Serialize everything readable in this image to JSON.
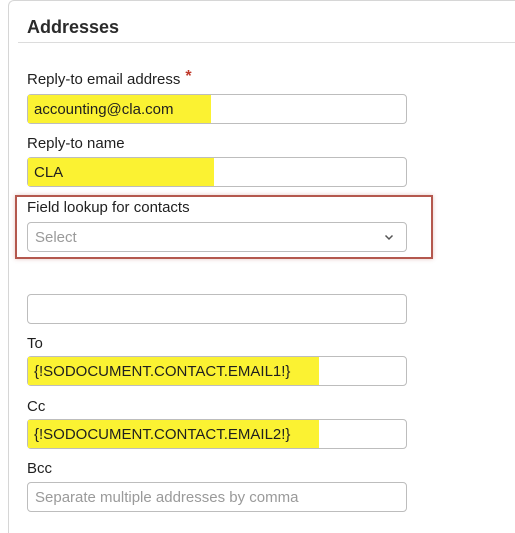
{
  "section": {
    "title": "Addresses"
  },
  "reply_to_email": {
    "label": "Reply-to email address",
    "required_mark": "*",
    "value": "accounting@cla.com"
  },
  "reply_to_name": {
    "label": "Reply-to name",
    "value": "CLA"
  },
  "field_lookup": {
    "label": "Field lookup for contacts",
    "placeholder": "Select"
  },
  "unlabeled_field": {
    "value": ""
  },
  "to": {
    "label": "To",
    "value": "{!SODOCUMENT.CONTACT.EMAIL1!}"
  },
  "cc": {
    "label": "Cc",
    "value": "{!SODOCUMENT.CONTACT.EMAIL2!}"
  },
  "bcc": {
    "label": "Bcc",
    "placeholder": "Separate multiple addresses by comma"
  },
  "colors": {
    "highlight": "#fbf232",
    "callout_border": "#b4584e",
    "required": "#c0392b"
  },
  "icons": {
    "dropdown": "chevron-down-icon"
  }
}
